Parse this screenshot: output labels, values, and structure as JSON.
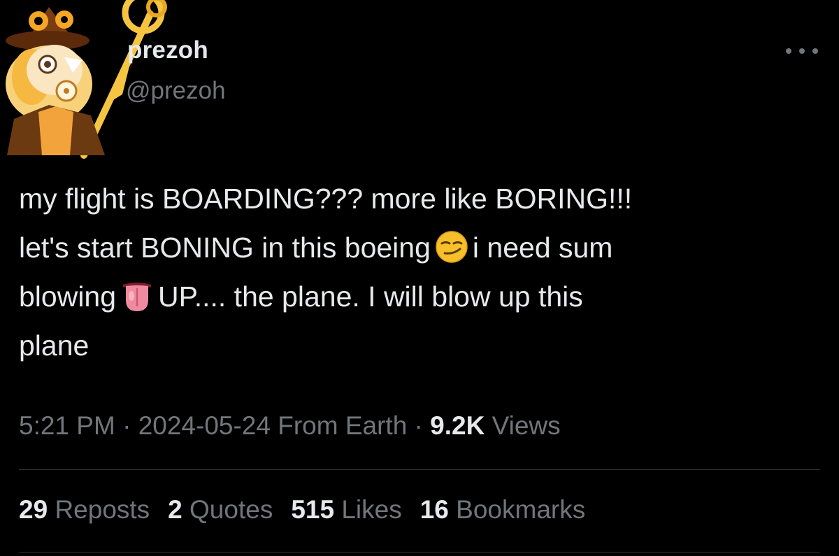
{
  "author": {
    "display_name": "prezoh",
    "handle": "@prezoh",
    "avatar": "cookie-character-avatar"
  },
  "more_icon": "more-horizontal-icon",
  "tweet": {
    "line1": "my flight is BOARDING??? more like BORING!!!",
    "line2_a": "let's start BONING in this boeing",
    "line2_b": "i need sum",
    "line3_a": "blowing",
    "line3_b": "UP.... the plane.  I will blow up this",
    "line4": "plane",
    "emoji1": "smirking-face-emoji",
    "emoji2": "tongue-emoji"
  },
  "meta": {
    "time": "5:21 PM",
    "sep1": " · ",
    "date": "2024-05-24",
    "source": "From Earth",
    "sep2": " · ",
    "views_count": "9.2K",
    "views_label": "Views"
  },
  "stats": [
    {
      "count": "29",
      "label": "Reposts"
    },
    {
      "count": "2",
      "label": "Quotes"
    },
    {
      "count": "515",
      "label": "Likes"
    },
    {
      "count": "16",
      "label": "Bookmarks"
    }
  ],
  "colors": {
    "background": "#000000",
    "primary_text": "#e7e9ea",
    "secondary_text": "#71767b",
    "divider": "#2f3336"
  }
}
